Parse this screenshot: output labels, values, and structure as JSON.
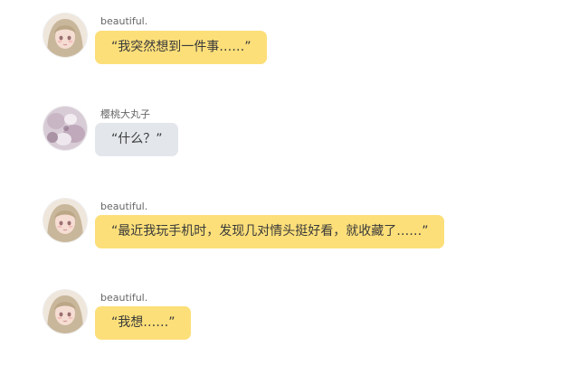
{
  "colors": {
    "bubble_yellow": "#fcdf79",
    "bubble_gray": "#e3e7ec",
    "background": "#ffffff",
    "sender_text": "#666666"
  },
  "messages": [
    {
      "sender": "beautiful.",
      "avatar": "girl-avatar-icon",
      "bubble_color": "yellow",
      "text": "“我突然想到一件事……”"
    },
    {
      "sender": "樱桃大丸子",
      "avatar": "cherry-avatar-icon",
      "bubble_color": "gray",
      "text": "“什么？”"
    },
    {
      "sender": "beautiful.",
      "avatar": "girl-avatar-icon",
      "bubble_color": "yellow",
      "text": "“最近我玩手机时，发现几对情头挺好看，就收藏了……”"
    },
    {
      "sender": "beautiful.",
      "avatar": "girl-avatar-icon",
      "bubble_color": "yellow",
      "text": "“我想……”"
    }
  ]
}
